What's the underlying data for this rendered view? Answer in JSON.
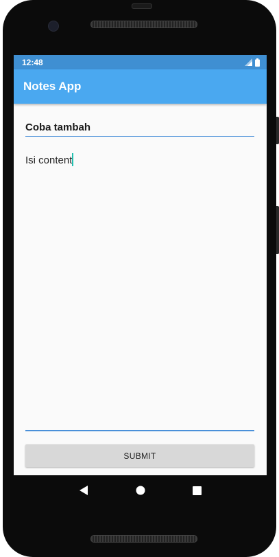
{
  "status_bar": {
    "time": "12:48",
    "signal_icon": "signal-icon",
    "battery_icon": "battery-icon"
  },
  "app_bar": {
    "title": "Notes App"
  },
  "form": {
    "title_value": "Coba tambah",
    "content_value": "Isi content",
    "submit_label": "SUBMIT"
  },
  "nav_bar": {
    "back_icon": "back-icon",
    "home_icon": "home-icon",
    "recents_icon": "recents-icon"
  },
  "colors": {
    "app_bar": "#4aa8f0",
    "status_bar": "#3f8fd2",
    "accent_underline": "#4a90d9",
    "cursor": "#20c0b0",
    "button": "#d8d8d8"
  }
}
